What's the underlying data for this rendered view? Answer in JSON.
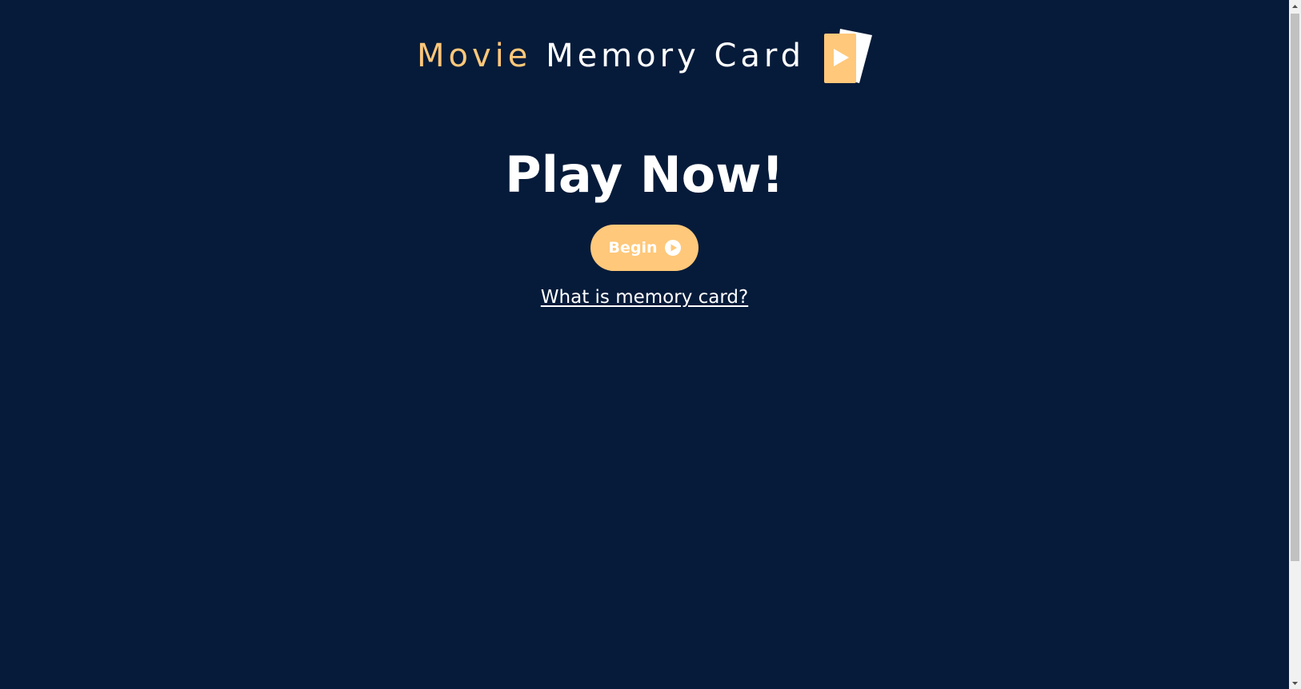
{
  "header": {
    "title_accent": "Movie",
    "title_rest": "Memory Card",
    "logo_icon": "play-card-icon"
  },
  "hero": {
    "title": "Play Now!",
    "begin_label": "Begin",
    "begin_icon": "play-circle-icon",
    "info_link": "What is memory card?"
  },
  "colors": {
    "background": "#061b3a",
    "accent": "#ffc87a",
    "text": "#ffffff"
  }
}
